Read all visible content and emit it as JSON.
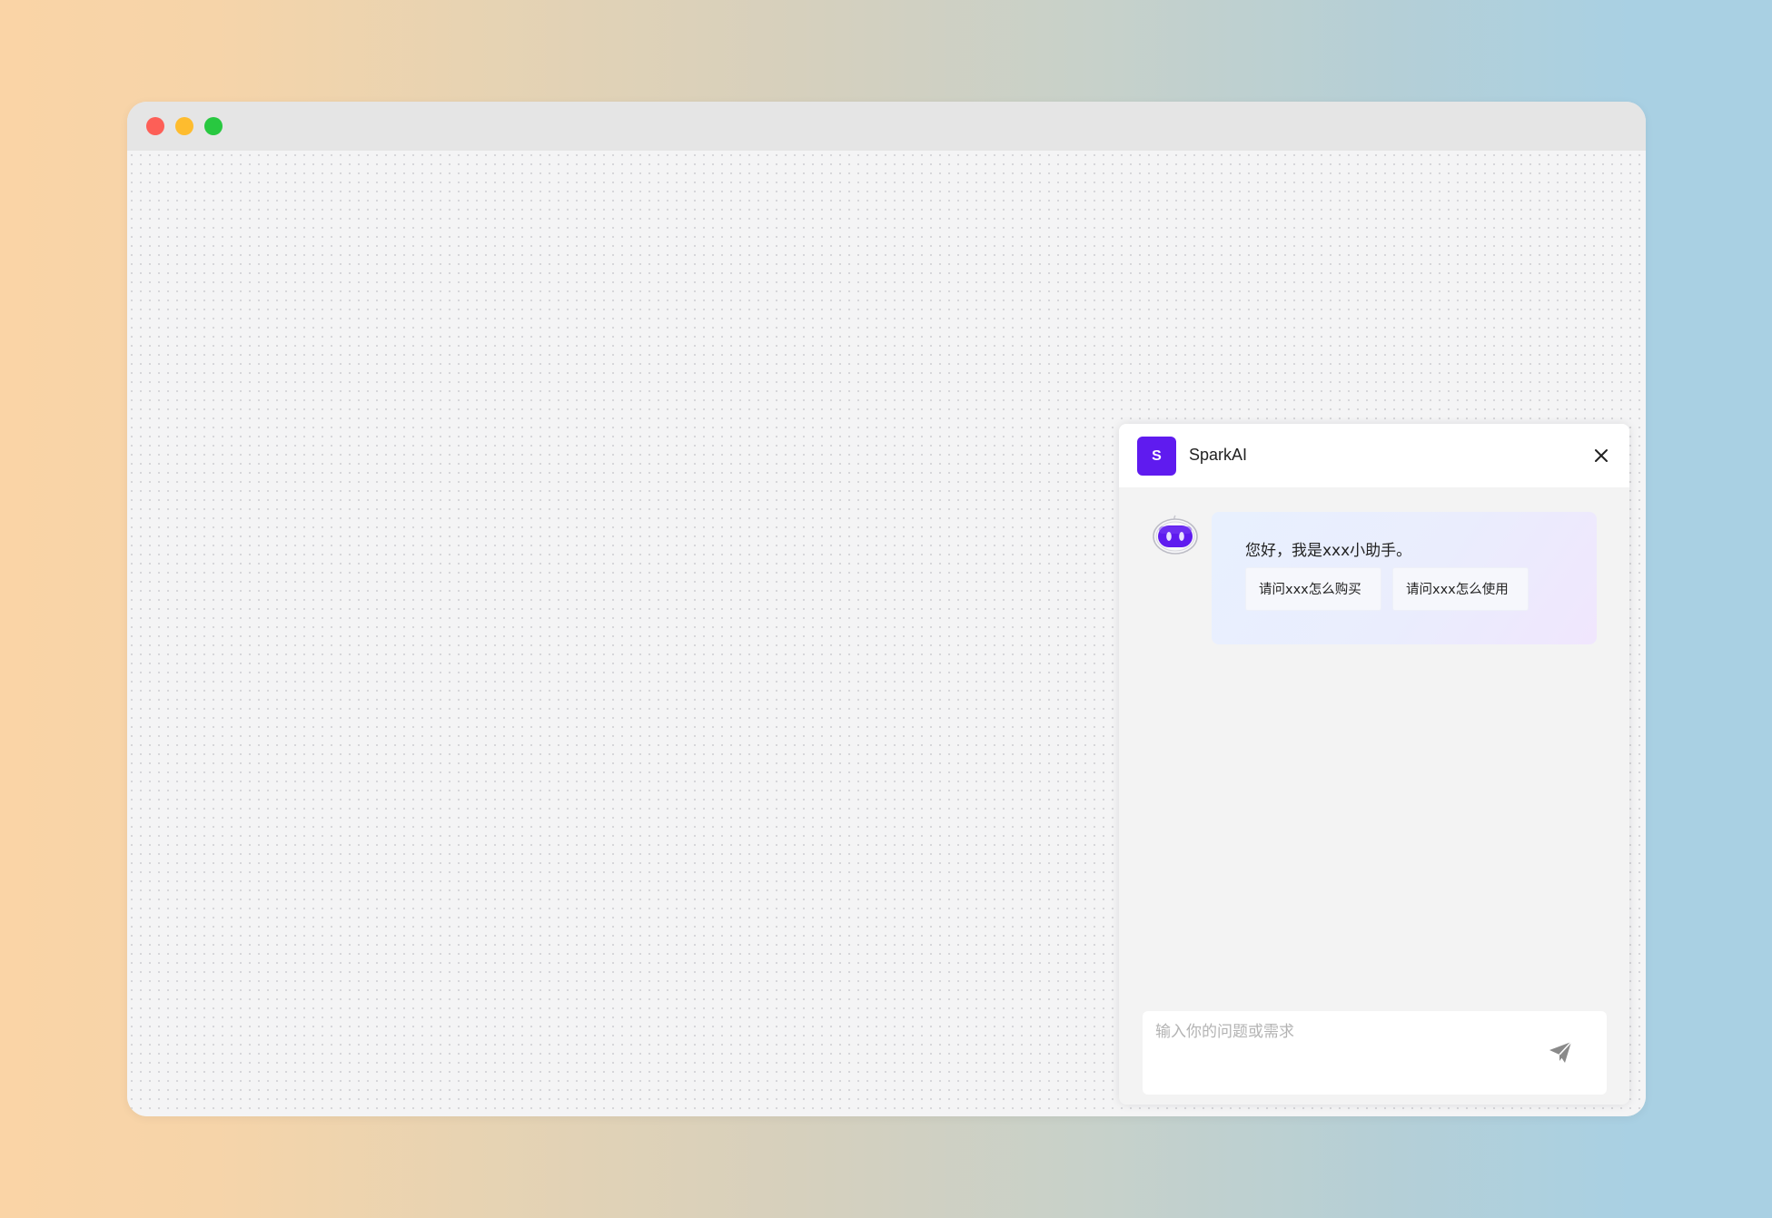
{
  "window": {
    "controls": [
      "close",
      "minimize",
      "maximize"
    ]
  },
  "chat": {
    "logo_letter": "S",
    "app_name": "SparkAI",
    "greeting": "您好，我是xxx小助手。",
    "suggestions": [
      "请问xxx怎么购买",
      "请问xxx怎么使用"
    ],
    "input_placeholder": "输入你的问题或需求",
    "input_value": "",
    "icons": {
      "close": "close-icon",
      "send": "send-icon",
      "bot": "robot-avatar-icon"
    },
    "colors": {
      "brand": "#5f1bef",
      "bubble_start": "#e8f0fe",
      "bubble_end": "#f0e6fd"
    }
  }
}
